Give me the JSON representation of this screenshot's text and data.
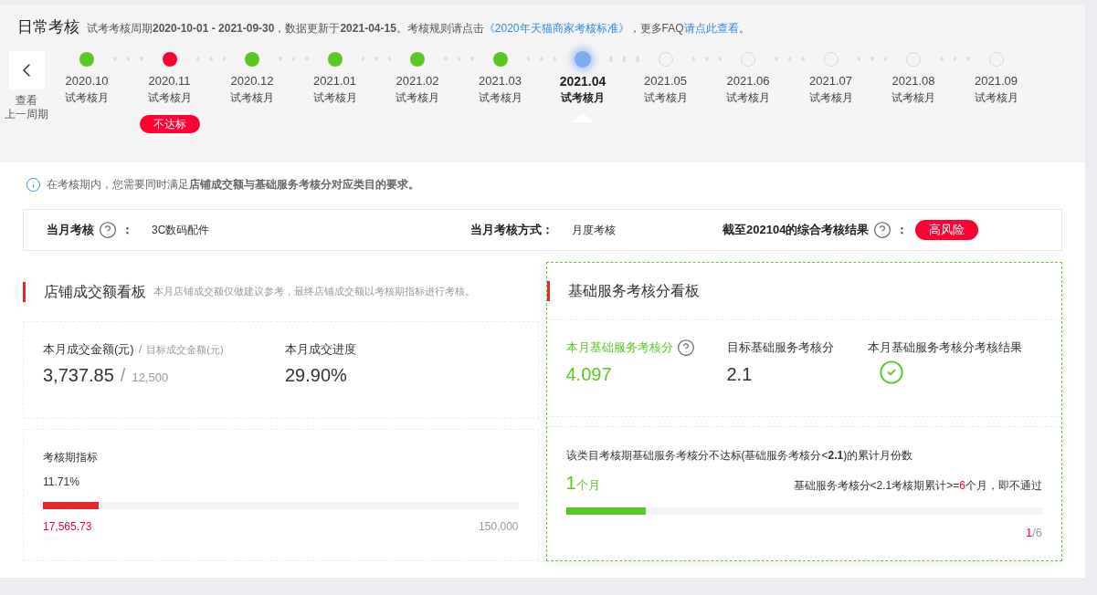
{
  "header": {
    "title": "日常考核",
    "note": [
      {
        "kind": "text",
        "text": "试考考核周期**2020-10-01 - 2021-09-30**，数据更新于**2021-04-15**。考核规则请点击"
      },
      {
        "kind": "link",
        "text": "《2020年天猫商家考核标准》"
      },
      {
        "kind": "text",
        "text": "，更多FAQ"
      },
      {
        "kind": "link",
        "text": "请点此查看"
      },
      {
        "kind": "text",
        "text": "。"
      }
    ]
  },
  "previous_period": {
    "lines": [
      "查看",
      "上一周期"
    ]
  },
  "timeline": {
    "months": [
      {
        "date": "2020.10",
        "label": "试考核月",
        "kind": "pass",
        "selected": false
      },
      {
        "date": "2020.11",
        "label": "试考核月",
        "kind": "fail",
        "selected": false,
        "badge": "不达标"
      },
      {
        "date": "2020.12",
        "label": "试考核月",
        "kind": "pass",
        "selected": false
      },
      {
        "date": "2021.01",
        "label": "试考核月",
        "kind": "pass",
        "selected": false
      },
      {
        "date": "2021.02",
        "label": "试考核月",
        "kind": "pass",
        "selected": false
      },
      {
        "date": "2021.03",
        "label": "试考核月",
        "kind": "pass",
        "selected": false
      },
      {
        "date": "2021.04",
        "label": "试考核月",
        "kind": "current",
        "selected": true
      },
      {
        "date": "2021.05",
        "label": "试考核月",
        "kind": "future",
        "selected": false
      },
      {
        "date": "2021.06",
        "label": "试考核月",
        "kind": "future",
        "selected": false
      },
      {
        "date": "2021.07",
        "label": "试考核月",
        "kind": "future",
        "selected": false
      },
      {
        "date": "2021.08",
        "label": "试考核月",
        "kind": "future",
        "selected": false
      },
      {
        "date": "2021.09",
        "label": "试考核月",
        "kind": "future",
        "selected": false
      }
    ]
  },
  "notice": "在考核期内，您需要同时满足**店铺成交额与基础服务考核分对应类目的要求。**",
  "summary": [
    {
      "label": "当月考核",
      "help": true,
      "colon": "：",
      "value": "3C数码配件",
      "kind": "text"
    },
    {
      "label": "当月考核方式：",
      "help": false,
      "value": "月度考核",
      "kind": "text"
    },
    {
      "label": "截至202104的综合考核结果",
      "help": true,
      "colon": "：",
      "value": "高风险",
      "kind": "badge"
    }
  ],
  "sales_board": {
    "title": "店铺成交额看板",
    "subtitle": "本月店铺成交额仅做建议参考，最终店铺成交额以考核期指标进行考核。",
    "amount": {
      "label": "本月成交金额(元)",
      "separator": "/",
      "target_label": "目标成交金额(元)",
      "value": "3,737.85",
      "value_separator": "/",
      "target": "12,500"
    },
    "progress": {
      "label": "本月成交进度",
      "value": "29.90%"
    },
    "period": {
      "title": "考核期指标",
      "percent": "11.71%",
      "level": 0.117,
      "current": "17,565.73",
      "total": "150,000"
    }
  },
  "service_board": {
    "title": "基础服务考核分看板",
    "metrics": [
      {
        "kind": "score",
        "label": "本月基础服务考核分",
        "help": true,
        "value": "4.097",
        "highlight": true
      },
      {
        "kind": "score",
        "label": "目标基础服务考核分",
        "help": false,
        "value": "2.1",
        "highlight": false
      },
      {
        "kind": "result",
        "label": "本月基础服务考核分考核结果",
        "passed": true
      }
    ],
    "failing_months": {
      "description": "该类目考核期基础服务考核分不达标(基础服务考核分<**2.1**)的累计月份数",
      "count": "1",
      "unit": "个月",
      "rule": [
        {
          "kind": "text",
          "text": "基础服务考核分<2.1考核期累计>="
        },
        {
          "kind": "alert",
          "text": "6"
        },
        {
          "kind": "text",
          "text": "个月，即不通过"
        }
      ],
      "level": 0.167,
      "fraction_value": "1",
      "fraction_total": "/6"
    }
  }
}
